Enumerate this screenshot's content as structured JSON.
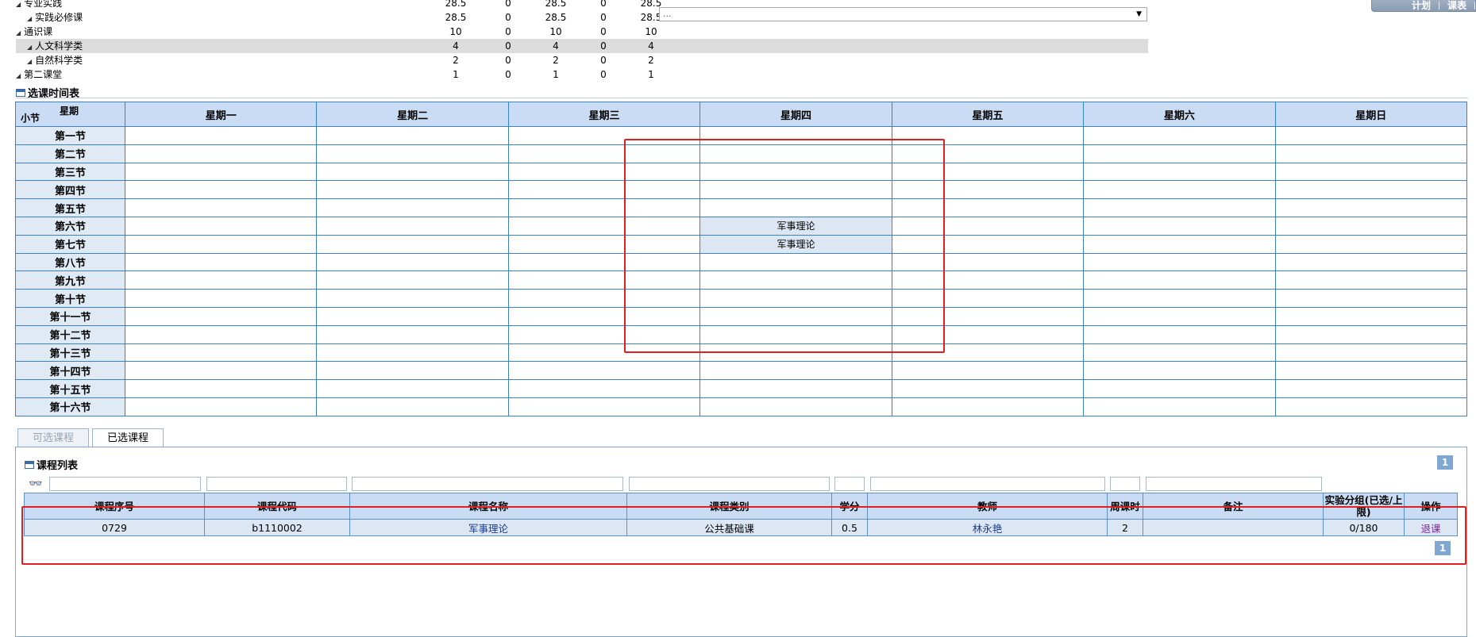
{
  "top_right": [
    "计划",
    "课表"
  ],
  "credit_tree": [
    {
      "label": "专业实践",
      "level": 0,
      "values": [
        "28.5",
        "0",
        "28.5",
        "0",
        "28.5"
      ]
    },
    {
      "label": "实践必修课",
      "level": 1,
      "values": [
        "28.5",
        "0",
        "28.5",
        "0",
        "28.5"
      ]
    },
    {
      "label": "通识课",
      "level": 0,
      "values": [
        "10",
        "0",
        "10",
        "0",
        "10"
      ]
    },
    {
      "label": "人文科学类",
      "level": 1,
      "values": [
        "4",
        "0",
        "4",
        "0",
        "4"
      ],
      "highlight": true
    },
    {
      "label": "自然科学类",
      "level": 1,
      "values": [
        "2",
        "0",
        "2",
        "0",
        "2"
      ]
    },
    {
      "label": "第二课堂",
      "level": 0,
      "values": [
        "1",
        "0",
        "1",
        "0",
        "1"
      ]
    }
  ],
  "select_value": "...",
  "timetable": {
    "title": "选课时间表",
    "corner_top": "星期",
    "corner_bottom": "小节",
    "days": [
      "星期一",
      "星期二",
      "星期三",
      "星期四",
      "星期五",
      "星期六",
      "星期日"
    ],
    "periods": [
      "第一节",
      "第二节",
      "第三节",
      "第四节",
      "第五节",
      "第六节",
      "第七节",
      "第八节",
      "第九节",
      "第十节",
      "第十一节",
      "第十二节",
      "第十三节",
      "第十四节",
      "第十五节",
      "第十六节"
    ],
    "courses": [
      {
        "period": 5,
        "day": 3,
        "name": "军事理论"
      },
      {
        "period": 6,
        "day": 3,
        "name": "军事理论"
      }
    ]
  },
  "tabs": [
    {
      "label": "可选课程",
      "active": false
    },
    {
      "label": "已选课程",
      "active": true
    }
  ],
  "course_list": {
    "title": "课程列表",
    "page": "1",
    "headers": [
      "课程序号",
      "课程代码",
      "课程名称",
      "课程类别",
      "学分",
      "教师",
      "周课时",
      "备注",
      "实验分组(已选/上限)",
      "操作"
    ],
    "rows": [
      [
        "0729",
        "b1110002",
        "军事理论",
        "公共基础课",
        "0.5",
        "林永艳",
        "2",
        "",
        "0/180",
        "退课"
      ]
    ]
  }
}
